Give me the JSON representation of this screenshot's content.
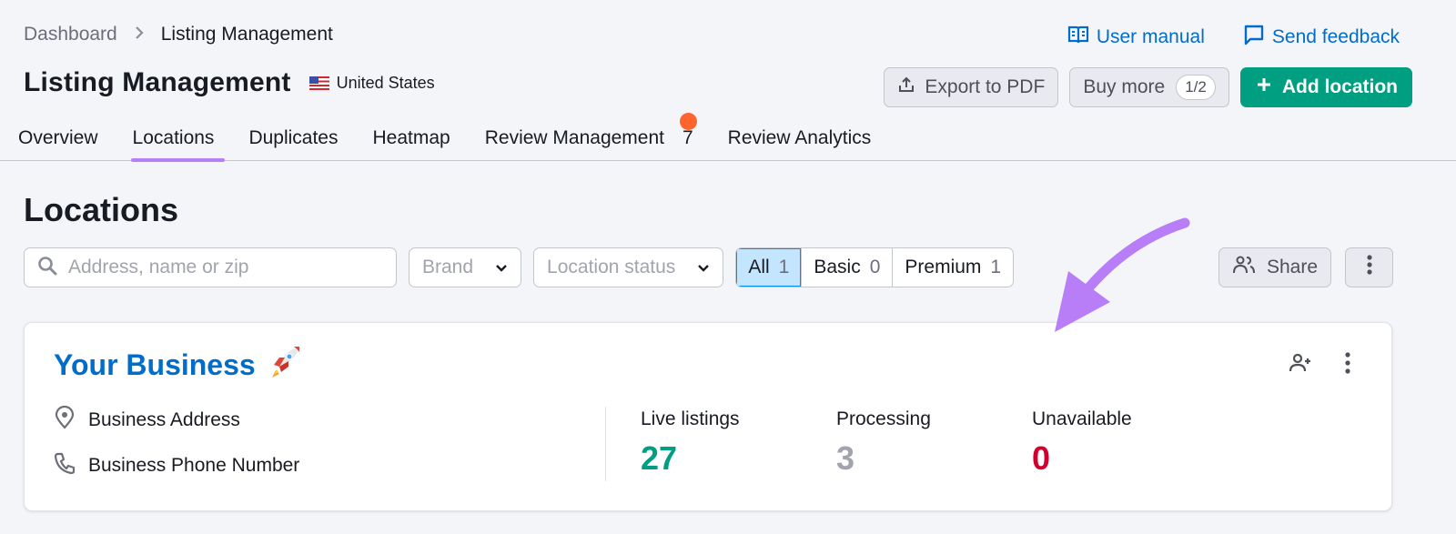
{
  "breadcrumb": {
    "home": "Dashboard",
    "separator": ">",
    "current": "Listing Management"
  },
  "top_links": {
    "user_manual": "User manual",
    "send_feedback": "Send feedback"
  },
  "header": {
    "title": "Listing Management",
    "country": "United States"
  },
  "actions": {
    "export": "Export to PDF",
    "buy_more": "Buy more",
    "buy_more_counter": "1/2",
    "add_location": "Add location"
  },
  "tabs": [
    {
      "label": "Overview"
    },
    {
      "label": "Locations",
      "active": true
    },
    {
      "label": "Duplicates"
    },
    {
      "label": "Heatmap"
    },
    {
      "label": "Review Management",
      "count": "7",
      "has_notification_dot": true
    },
    {
      "label": "Review Analytics"
    }
  ],
  "section": {
    "title": "Locations"
  },
  "filters": {
    "search_placeholder": "Address, name or zip",
    "brand": "Brand",
    "location_status": "Location status",
    "segments": [
      {
        "label": "All",
        "count": "1",
        "active": true
      },
      {
        "label": "Basic",
        "count": "0"
      },
      {
        "label": "Premium",
        "count": "1"
      }
    ],
    "share": "Share"
  },
  "business": {
    "name": "Your Business",
    "emoji": "rocket",
    "address": "Business Address",
    "phone": "Business Phone Number",
    "stats": [
      {
        "label": "Live listings",
        "value": "27",
        "color": "#009f81"
      },
      {
        "label": "Processing",
        "value": "3",
        "color": "#a2a4ad"
      },
      {
        "label": "Unavailable",
        "value": "0",
        "color": "#d1002f"
      }
    ]
  },
  "colors": {
    "accent": "#006dca",
    "primary": "#009f81",
    "tab_active": "#b77ef7",
    "annotation": "#b77ef7",
    "notification": "#ff642d"
  }
}
